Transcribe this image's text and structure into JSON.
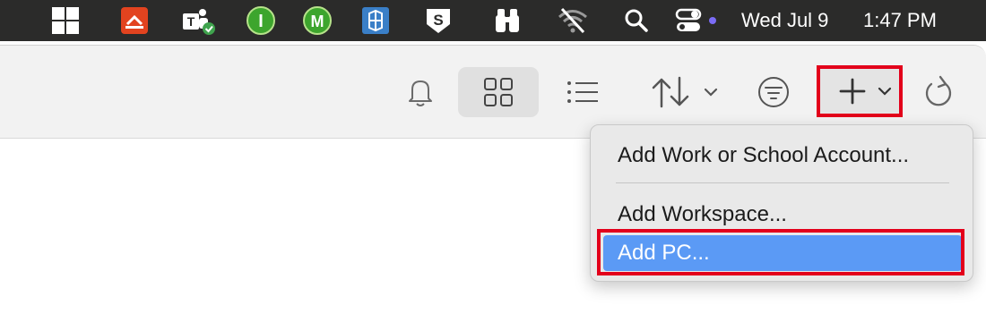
{
  "menubar": {
    "date": "Wed Jul 9",
    "time": "1:47 PM",
    "icons": [
      "windows-icon",
      "anydesk-icon",
      "teams-icon",
      "green-i-icon",
      "green-m-icon",
      "blue-app-icon",
      "s-shield-icon",
      "binoculars-icon",
      "wifi-off-icon",
      "search-icon",
      "control-center-icon"
    ]
  },
  "toolbar": {
    "icons": [
      "bell-icon",
      "grid-view-icon",
      "list-view-icon",
      "sort-icon",
      "filter-icon",
      "add-icon",
      "refresh-icon"
    ]
  },
  "menu": {
    "items": [
      {
        "label": "Add Work or School Account..."
      },
      {
        "label": "Add Workspace..."
      },
      {
        "label": "Add PC..."
      }
    ]
  },
  "colors": {
    "highlight": "#e3001b",
    "selection": "#5b9af5"
  }
}
